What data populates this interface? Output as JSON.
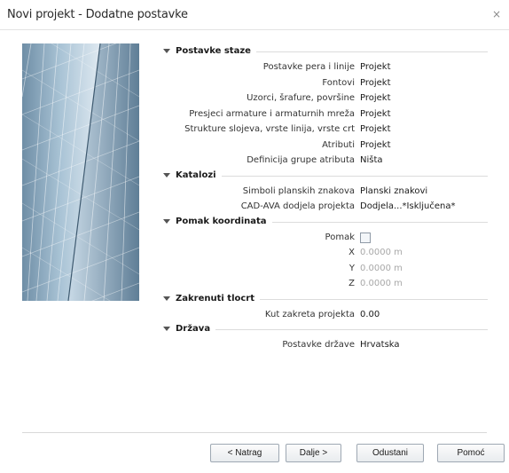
{
  "window": {
    "title": "Novi projekt - Dodatne postavke",
    "close_glyph": "×"
  },
  "sections": [
    {
      "title": "Postavke staze",
      "rows": [
        {
          "label": "Postavke pera i linije",
          "value": "Projekt"
        },
        {
          "label": "Fontovi",
          "value": "Projekt"
        },
        {
          "label": "Uzorci, šrafure, površine",
          "value": "Projekt"
        },
        {
          "label": "Presjeci armature i armaturnih mreža",
          "value": "Projekt"
        },
        {
          "label": "Strukture slojeva, vrste linija, vrste crt",
          "value": "Projekt"
        },
        {
          "label": "Atributi",
          "value": "Projekt"
        },
        {
          "label": "Definicija grupe atributa",
          "value": "Ništa"
        }
      ]
    },
    {
      "title": "Katalozi",
      "rows": [
        {
          "label": "Simboli planskih znakova",
          "value": "Planski znakovi"
        },
        {
          "label": "CAD-AVA dodjela projekta",
          "value": "Dodjela...*Isključena*"
        }
      ]
    },
    {
      "title": "Pomak koordinata",
      "checkbox_label": "Pomak",
      "checkbox_checked": false,
      "rows": [
        {
          "label": "X",
          "value": "0.0000 m"
        },
        {
          "label": "Y",
          "value": "0.0000 m"
        },
        {
          "label": "Z",
          "value": "0.0000 m"
        }
      ]
    },
    {
      "title": "Zakrenuti tlocrt",
      "rows": [
        {
          "label": "Kut zakreta projekta",
          "value": "0.00"
        }
      ]
    },
    {
      "title": "Država",
      "rows": [
        {
          "label": "Postavke države",
          "value": "Hrvatska"
        }
      ]
    }
  ],
  "buttons": {
    "back": "< Natrag",
    "next": "Dalje >",
    "cancel": "Odustani",
    "help": "Pomoć"
  },
  "icons": {
    "close": "close-icon",
    "section_toggle": "triangle-down-icon",
    "side_image": "glass-skyscraper-image"
  },
  "colors": {
    "text": "#1a1a1a",
    "disabled_text": "#a8a8a8",
    "separator": "#dcdcdc"
  }
}
